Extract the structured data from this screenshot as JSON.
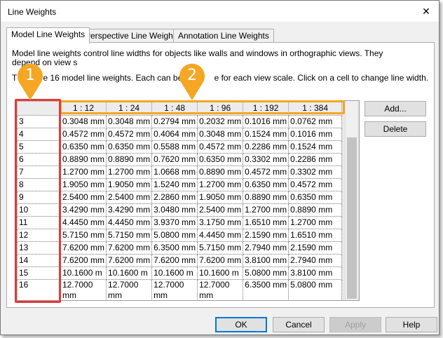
{
  "window": {
    "title": "Line Weights",
    "close_label": "✕"
  },
  "tabs": [
    {
      "label": "Model Line Weights"
    },
    {
      "label": "Perspective Line Weights"
    },
    {
      "label": "Annotation Line Weights"
    }
  ],
  "description": {
    "line1": "Model line weights control line widths for objects like walls and windows in orthographic views. They depend on view s",
    "line2": "T          re 16 model line weights. Each can be giv        e for each view scale. Click on a cell to change line width."
  },
  "grid": {
    "columns": [
      "1 : 12",
      "1 : 24",
      "1 : 48",
      "1 : 96",
      "1 : 192",
      "1 : 384"
    ],
    "rows": [
      {
        "id": "3",
        "values": [
          "0.3048 mm",
          "0.3048 mm",
          "0.2794 mm",
          "0.2032 mm",
          "0.1016 mm",
          "0.0762 mm"
        ]
      },
      {
        "id": "4",
        "values": [
          "0.4572 mm",
          "0.4572 mm",
          "0.4064 mm",
          "0.3048 mm",
          "0.1524 mm",
          "0.1016 mm"
        ]
      },
      {
        "id": "5",
        "values": [
          "0.6350 mm",
          "0.6350 mm",
          "0.5588 mm",
          "0.4572 mm",
          "0.2286 mm",
          "0.1524 mm"
        ]
      },
      {
        "id": "6",
        "values": [
          "0.8890 mm",
          "0.8890 mm",
          "0.7620 mm",
          "0.6350 mm",
          "0.3302 mm",
          "0.2286 mm"
        ]
      },
      {
        "id": "7",
        "values": [
          "1.2700 mm",
          "1.2700 mm",
          "1.0668 mm",
          "0.8890 mm",
          "0.4572 mm",
          "0.3302 mm"
        ]
      },
      {
        "id": "8",
        "values": [
          "1.9050 mm",
          "1.9050 mm",
          "1.5240 mm",
          "1.2700 mm",
          "0.6350 mm",
          "0.4572 mm"
        ]
      },
      {
        "id": "9",
        "values": [
          "2.5400 mm",
          "2.5400 mm",
          "2.2860 mm",
          "1.9050 mm",
          "0.8890 mm",
          "0.6350 mm"
        ]
      },
      {
        "id": "10",
        "values": [
          "3.4290 mm",
          "3.4290 mm",
          "3.0480 mm",
          "2.5400 mm",
          "1.2700 mm",
          "0.8890 mm"
        ]
      },
      {
        "id": "11",
        "values": [
          "4.4450 mm",
          "4.4450 mm",
          "3.9370 mm",
          "3.1750 mm",
          "1.6510 mm",
          "1.2700 mm"
        ]
      },
      {
        "id": "12",
        "values": [
          "5.7150 mm",
          "5.7150 mm",
          "5.0800 mm",
          "4.4450 mm",
          "2.1590 mm",
          "1.6510 mm"
        ]
      },
      {
        "id": "13",
        "values": [
          "7.6200 mm",
          "7.6200 mm",
          "6.3500 mm",
          "5.7150 mm",
          "2.7940 mm",
          "2.1590 mm"
        ]
      },
      {
        "id": "14",
        "values": [
          "7.6200 mm",
          "7.6200 mm",
          "7.6200 mm",
          "7.6200 mm",
          "3.8100 mm",
          "2.7940 mm"
        ]
      },
      {
        "id": "15",
        "values": [
          "10.1600 m",
          "10.1600 m",
          "10.1600 m",
          "10.1600 m",
          "5.0800 mm",
          "3.8100 mm"
        ]
      },
      {
        "id": "16",
        "values": [
          "12.7000 mm",
          "12.7000 mm",
          "12.7000 mm",
          "12.7000 mm",
          "6.3500 mm",
          "5.0800 mm"
        ]
      }
    ]
  },
  "side_buttons": {
    "add": "Add...",
    "delete": "Delete"
  },
  "footer_buttons": {
    "ok": "OK",
    "cancel": "Cancel",
    "apply": "Apply",
    "help": "Help"
  },
  "callouts": [
    {
      "number": "1",
      "color": "#f5a623"
    },
    {
      "number": "2",
      "color": "#f5a623"
    }
  ],
  "colors": {
    "highlight_orange": "#f5a623",
    "highlight_red": "#e33a3a",
    "ok_border": "#0078d7"
  }
}
